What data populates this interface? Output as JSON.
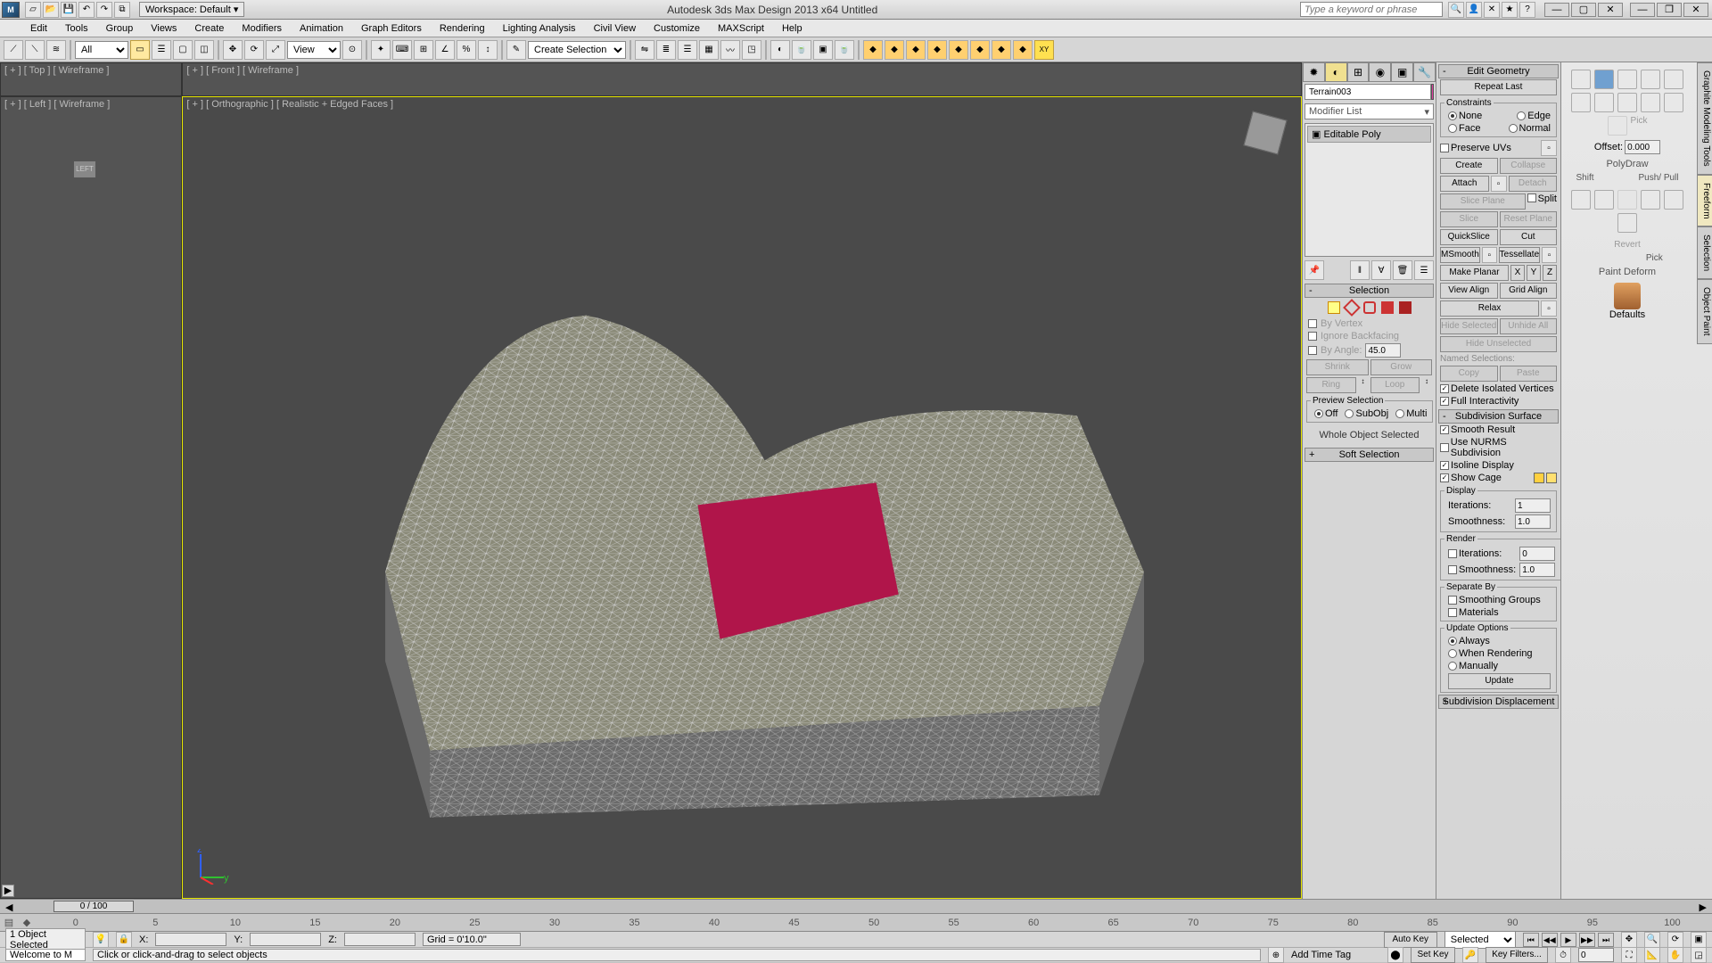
{
  "titlebar": {
    "workspace": "Workspace: Default",
    "app_title": "Autodesk 3ds Max Design 2013 x64      Untitled",
    "search_placeholder": "Type a keyword or phrase"
  },
  "menus": [
    "Edit",
    "Tools",
    "Group",
    "Views",
    "Create",
    "Modifiers",
    "Animation",
    "Graph Editors",
    "Rendering",
    "Lighting Analysis",
    "Civil View",
    "Customize",
    "MAXScript",
    "Help"
  ],
  "toolbar": {
    "filter": "All",
    "namedsel": "Create Selection Se",
    "view": "View"
  },
  "viewports": {
    "top": "[ + ] [ Top ] [ Wireframe ]",
    "front": "[ + ] [ Front ] [ Wireframe ]",
    "left": "[ + ] [ Left ] [ Wireframe ]",
    "persp": "[ + ] [ Orthographic ] [ Realistic + Edged Faces ]"
  },
  "command_panel": {
    "object_name": "Terrain003",
    "modifier_list": "Modifier List",
    "stack_item": "Editable Poly",
    "selection_hdr": "Selection",
    "by_vertex": "By Vertex",
    "ignore_backfacing": "Ignore Backfacing",
    "by_angle": "By Angle:",
    "by_angle_val": "45.0",
    "shrink": "Shrink",
    "grow": "Grow",
    "ring": "Ring",
    "loop": "Loop",
    "preview_selection": "Preview Selection",
    "off": "Off",
    "subobj": "SubObj",
    "multi": "Multi",
    "whole_obj": "Whole Object Selected",
    "soft_selection": "Soft Selection"
  },
  "edit_panel": {
    "edit_geometry": "Edit Geometry",
    "repeat_last": "Repeat Last",
    "constraints": "Constraints",
    "none": "None",
    "edge": "Edge",
    "face": "Face",
    "normal": "Normal",
    "preserve_uvs": "Preserve UVs",
    "create": "Create",
    "collapse": "Collapse",
    "attach": "Attach",
    "detach": "Detach",
    "slice_plane": "Slice Plane",
    "split": "Split",
    "slice": "Slice",
    "reset_plane": "Reset Plane",
    "quickslice": "QuickSlice",
    "cut": "Cut",
    "msmooth": "MSmooth",
    "tessellate": "Tessellate",
    "make_planar": "Make Planar",
    "view_align": "View Align",
    "grid_align": "Grid Align",
    "relax": "Relax",
    "hide_selected": "Hide Selected",
    "unhide_all": "Unhide All",
    "hide_unselected": "Hide Unselected",
    "named_selections": "Named Selections:",
    "copy": "Copy",
    "paste": "Paste",
    "delete_isolated": "Delete Isolated Vertices",
    "full_interactivity": "Full Interactivity",
    "subdiv_surface": "Subdivision Surface",
    "smooth_result": "Smooth Result",
    "use_nurms": "Use NURMS Subdivision",
    "isoline": "Isoline Display",
    "show_cage": "Show Cage",
    "display": "Display",
    "iterations": "Iterations:",
    "iterations_val": "1",
    "smoothness": "Smoothness:",
    "smoothness_val": "1.0",
    "render": "Render",
    "render_iter_val": "0",
    "render_smooth_val": "1.0",
    "separate_by": "Separate By",
    "smoothing_groups": "Smoothing Groups",
    "materials": "Materials",
    "update_options": "Update Options",
    "always": "Always",
    "when_rendering": "When Rendering",
    "manually": "Manually",
    "update": "Update",
    "subdiv_displacement": "Subdivision Displacement"
  },
  "graphite": {
    "tabs": [
      "Graphite Modeling Tools",
      "Freeform",
      "Selection",
      "Object Paint"
    ],
    "offset_label": "Offset:",
    "offset_val": "0.000",
    "polydraw": "PolyDraw",
    "shift": "Shift",
    "pushpull": "Push/ Pull",
    "revert": "Revert",
    "pick": "Pick",
    "paint_deform": "Paint Deform",
    "defaults": "Defaults",
    "pick2": "Pick"
  },
  "timeline": {
    "pos": "0 / 100",
    "ticks": [
      "0",
      "5",
      "10",
      "15",
      "20",
      "25",
      "30",
      "35",
      "40",
      "45",
      "50",
      "55",
      "60",
      "65",
      "70",
      "75",
      "80",
      "85",
      "90",
      "95",
      "100"
    ]
  },
  "status": {
    "selected": "1 Object Selected",
    "prompt": "Click or click-and-drag to select objects",
    "x": "X:",
    "y": "Y:",
    "z": "Z:",
    "grid": "Grid = 0'10.0\"",
    "add_time_tag": "Add Time Tag",
    "auto_key": "Auto Key",
    "set_key": "Set Key",
    "selected_filter": "Selected",
    "key_filters": "Key Filters...",
    "frame": "0",
    "welcome": "Welcome to M"
  }
}
